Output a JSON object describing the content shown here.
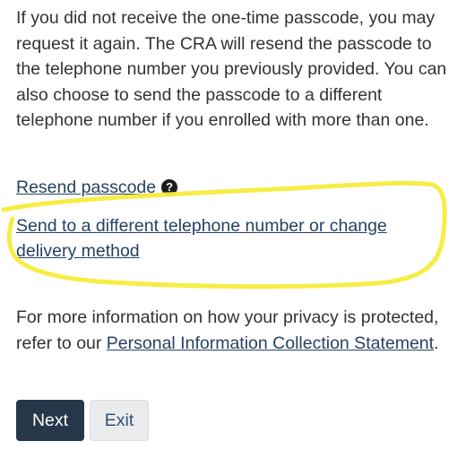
{
  "intro": {
    "paragraph": "If you did not receive the one-time passcode, you may request it again. The CRA will resend the passcode to the telephone number you previously provided. You can also choose to send the passcode to a different telephone number if you enrolled with more than one."
  },
  "links": {
    "resend": "Resend passcode",
    "help_icon": "?",
    "send_other": "Send to a different telephone number or change delivery method"
  },
  "privacy": {
    "text_before": "For more information on how your privacy is protected, refer to our ",
    "link": "Personal Information Collection Statement",
    "text_after": "."
  },
  "buttons": {
    "next": "Next",
    "exit": "Exit"
  },
  "colors": {
    "link": "#284162",
    "primary_button": "#26374a",
    "highlight": "#f5ec3c"
  }
}
